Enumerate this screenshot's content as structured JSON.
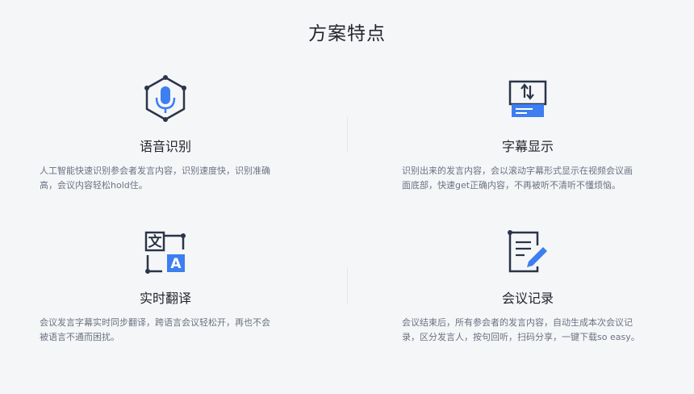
{
  "page": {
    "title": "方案特点"
  },
  "features": [
    {
      "icon": "microphone-hexagon-icon",
      "title": "语音识别",
      "desc_lines": [
        "人工智能快速识别参会者发言内容，识别速度快，识别准确",
        "高，会议内容轻松hold住。"
      ]
    },
    {
      "icon": "subtitle-screen-icon",
      "title": "字幕显示",
      "desc_lines": [
        "识别出来的发言内容，会以滚动字幕形式显示在视频会议画",
        "面底部，快速get正确内容，不再被听不清听不懂烦恼。"
      ]
    },
    {
      "icon": "translate-icon",
      "title": "实时翻译",
      "desc_lines": [
        "会议发言字幕实时同步翻译，跨语言会议轻松开，再也不会",
        "被语言不通而困扰。"
      ]
    },
    {
      "icon": "document-edit-icon",
      "title": "会议记录",
      "desc_lines": [
        "会议结束后，所有参会者的发言内容，自动生成本次会议记",
        "录，区分发言人，按句回听，扫码分享，一键下载so easy。"
      ]
    }
  ],
  "icon_text": {
    "translate_zh": "文",
    "translate_en": "A"
  },
  "colors": {
    "accent": "#3d7ef0",
    "dark": "#2b3448",
    "text": "#6a7282",
    "title": "#23262e"
  }
}
